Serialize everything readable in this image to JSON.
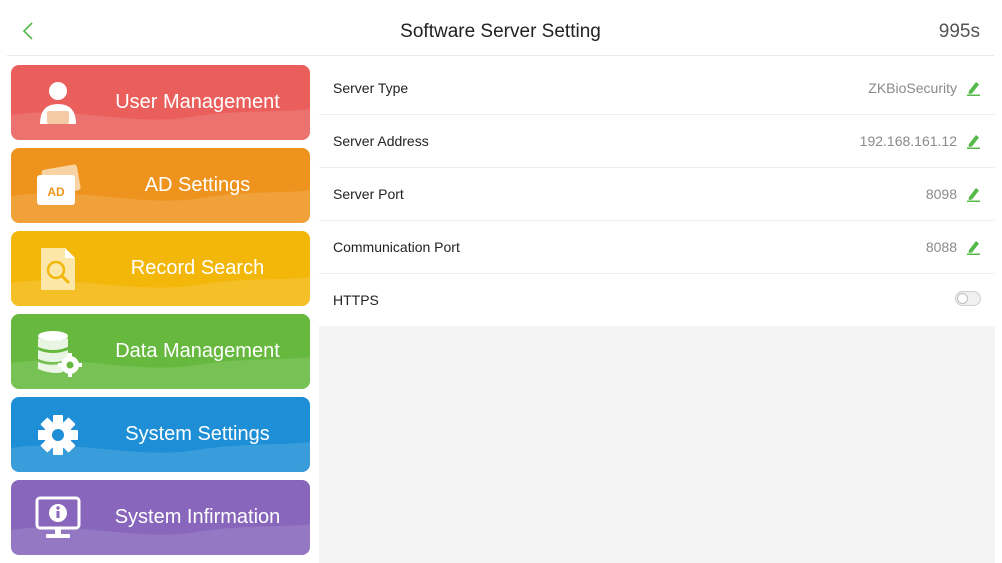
{
  "header": {
    "title": "Software Server Setting",
    "countdown": "995s"
  },
  "menu": {
    "items": [
      {
        "label": "User Management",
        "icon": "user-icon",
        "color": "#ea5f5c"
      },
      {
        "label": "AD Settings",
        "icon": "ad-icon",
        "icon_text": "AD",
        "color": "#ee941e"
      },
      {
        "label": "Record Search",
        "icon": "search-record-icon",
        "color": "#f3b70a"
      },
      {
        "label": "Data Management",
        "icon": "database-gear-icon",
        "color": "#66b93e"
      },
      {
        "label": "System Settings",
        "icon": "gear-icon",
        "color": "#1e8fd6"
      },
      {
        "label": "System Infirmation",
        "icon": "monitor-info-icon",
        "color": "#8766bb"
      }
    ]
  },
  "settings": {
    "rows": [
      {
        "label": "Server Type",
        "value": "ZKBioSecurity",
        "icon": "edit-pencil-icon"
      },
      {
        "label": "Server Address",
        "value": "192.168.161.12",
        "icon": "edit-pencil-icon"
      },
      {
        "label": "Server Port",
        "value": "8098",
        "icon": "edit-pencil-icon"
      },
      {
        "label": "Communication Port",
        "value": "8088",
        "icon": "edit-pencil-icon"
      },
      {
        "label": "HTTPS",
        "toggle": false
      }
    ]
  },
  "colors": {
    "accent_green": "#55b94a"
  }
}
